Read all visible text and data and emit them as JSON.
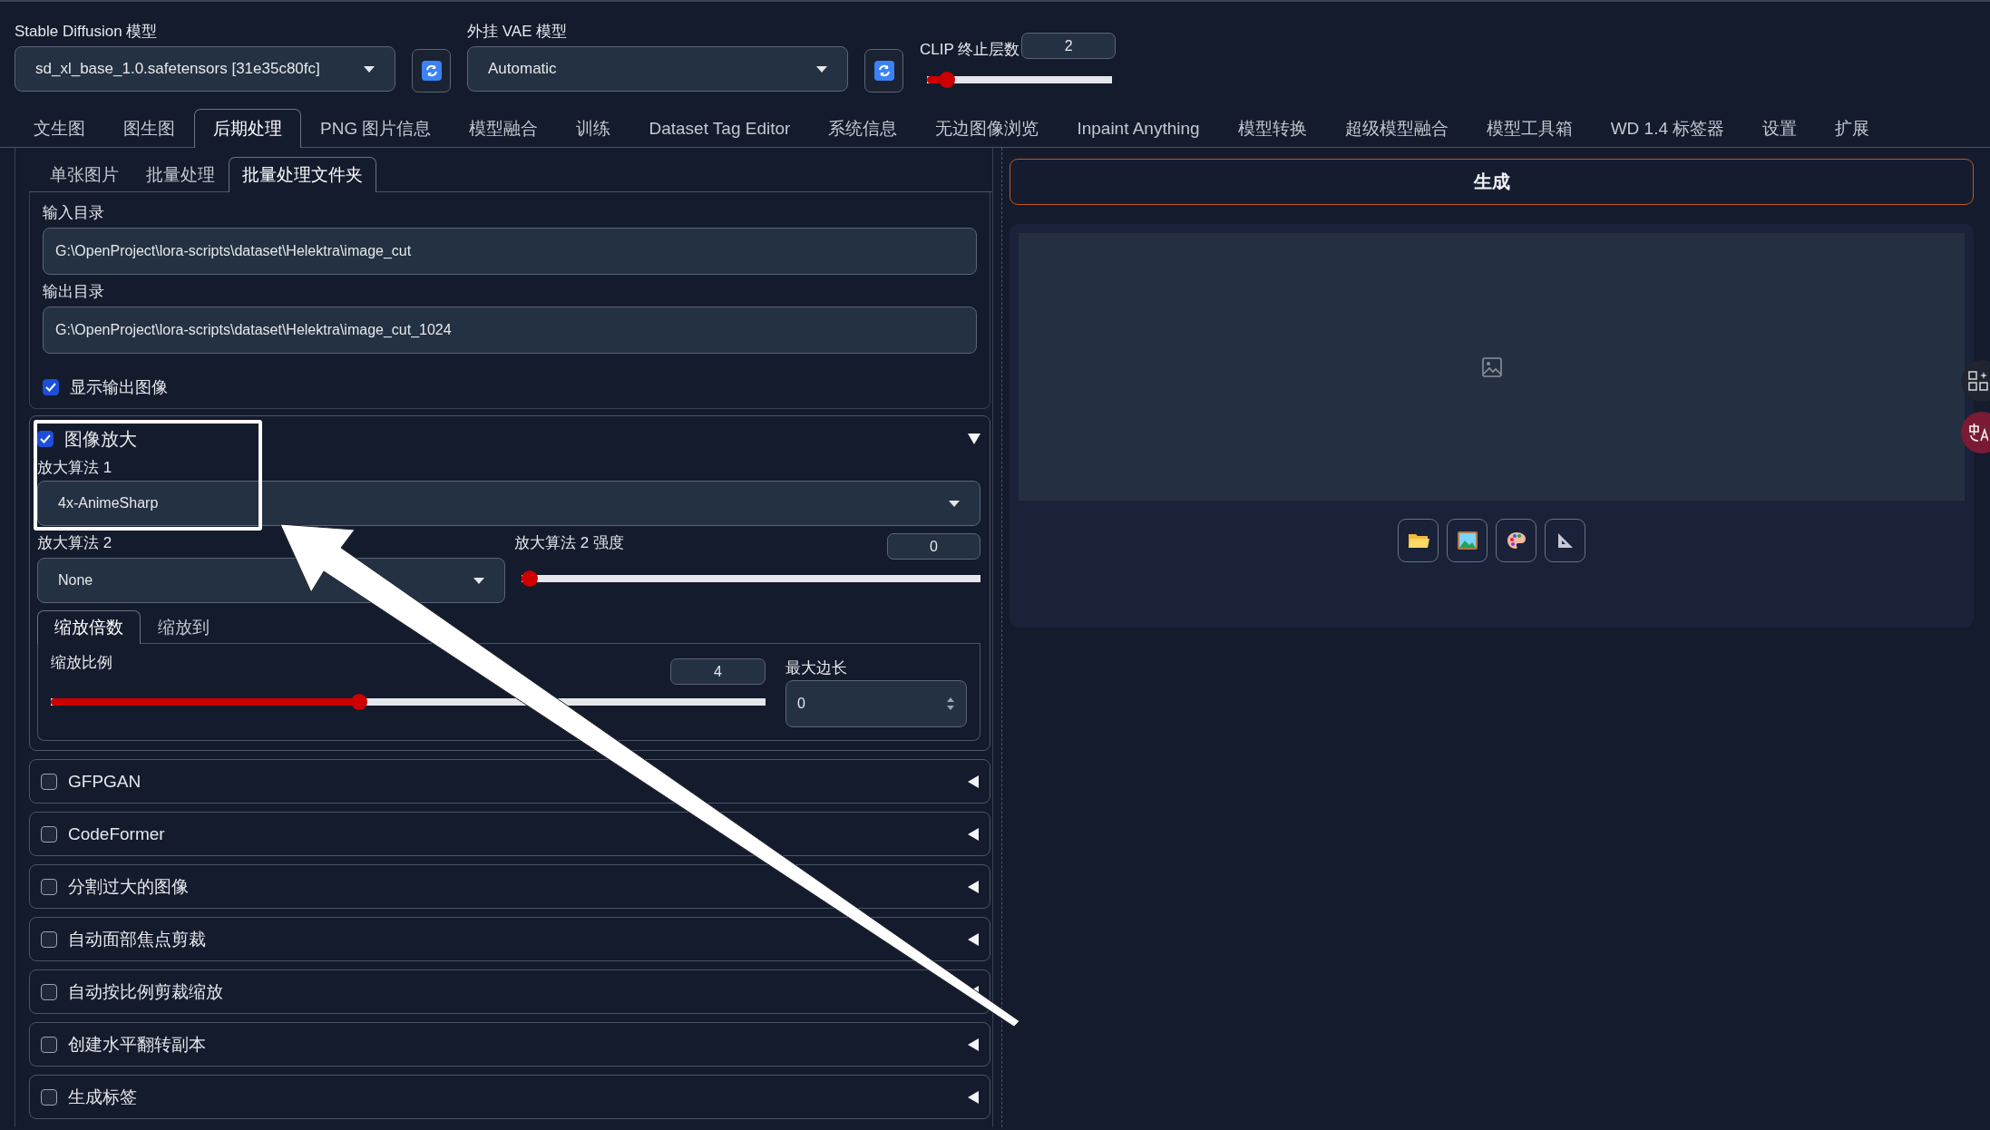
{
  "model_bar": {
    "sd_model": {
      "label": "Stable Diffusion 模型",
      "value": "sd_xl_base_1.0.safetensors [31e35c80fc]"
    },
    "vae": {
      "label": "外挂 VAE 模型",
      "value": "Automatic"
    },
    "clip": {
      "label": "CLIP 终止层数",
      "value": "2",
      "level": 0.07
    }
  },
  "tabs": [
    {
      "label": "文生图",
      "selected": false
    },
    {
      "label": "图生图",
      "selected": false
    },
    {
      "label": "后期处理",
      "selected": true
    },
    {
      "label": "PNG 图片信息",
      "selected": false
    },
    {
      "label": "模型融合",
      "selected": false
    },
    {
      "label": "训练",
      "selected": false
    },
    {
      "label": "Dataset Tag Editor",
      "selected": false
    },
    {
      "label": "系统信息",
      "selected": false
    },
    {
      "label": "无边图像浏览",
      "selected": false
    },
    {
      "label": "Inpaint Anything",
      "selected": false
    },
    {
      "label": "模型转换",
      "selected": false
    },
    {
      "label": "超级模型融合",
      "selected": false
    },
    {
      "label": "模型工具箱",
      "selected": false
    },
    {
      "label": "WD 1.4 标签器",
      "selected": false
    },
    {
      "label": "设置",
      "selected": false
    },
    {
      "label": "扩展",
      "selected": false
    }
  ],
  "sub_tabs": [
    {
      "label": "单张图片",
      "selected": false
    },
    {
      "label": "批量处理",
      "selected": false
    },
    {
      "label": "批量处理文件夹",
      "selected": true
    }
  ],
  "input_dir": {
    "label": "输入目录",
    "value": "G:\\OpenProject\\lora-scripts\\dataset\\Helektra\\image_cut"
  },
  "output_dir": {
    "label": "输出目录",
    "value": "G:\\OpenProject\\lora-scripts\\dataset\\Helektra\\image_cut_1024"
  },
  "show_output": {
    "label": "显示输出图像",
    "checked": true
  },
  "upscale": {
    "label": "图像放大",
    "checked": true,
    "expanded": true,
    "upscaler_1": {
      "label": "放大算法 1",
      "value": "4x-AnimeSharp"
    },
    "upscaler_2": {
      "label": "放大算法 2",
      "value": "None"
    },
    "upscaler_2_strength": {
      "label": "放大算法 2 强度",
      "value": "0",
      "level": 0
    },
    "mode_tabs": [
      {
        "label": "缩放倍数",
        "selected": true
      },
      {
        "label": "缩放到",
        "selected": false
      }
    ],
    "scale": {
      "label": "缩放比例",
      "value": "4",
      "level": 0.43
    },
    "max_side": {
      "label": "最大边长",
      "value": "0"
    }
  },
  "sections": [
    {
      "label": "GFPGAN",
      "checked": false,
      "expanded": false
    },
    {
      "label": "CodeFormer",
      "checked": false,
      "expanded": false
    },
    {
      "label": "分割过大的图像",
      "checked": false,
      "expanded": false
    },
    {
      "label": "自动面部焦点剪裁",
      "checked": false,
      "expanded": false
    },
    {
      "label": "自动按比例剪裁缩放",
      "checked": false,
      "expanded": false
    },
    {
      "label": "创建水平翻转副本",
      "checked": false,
      "expanded": false
    },
    {
      "label": "生成标签",
      "checked": false,
      "expanded": false
    }
  ],
  "generate_button": "生成"
}
